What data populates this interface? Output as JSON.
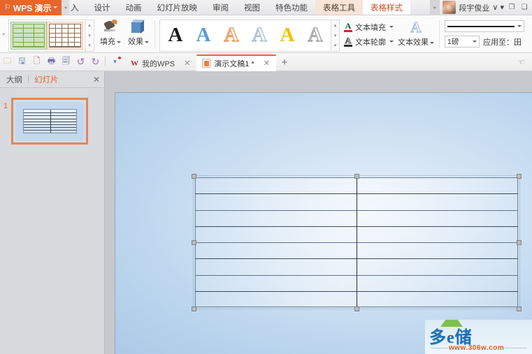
{
  "app": {
    "logo_text": "WPS 演示",
    "logo_icon": "wps-flag-icon",
    "logo_caret": "▾"
  },
  "menubar": {
    "scroll_left": "◂",
    "scroll_right": "▸",
    "tabs": [
      {
        "label": "入",
        "type": "clipped"
      },
      {
        "label": "设计",
        "type": "normal"
      },
      {
        "label": "动画",
        "type": "normal"
      },
      {
        "label": "幻灯片放映",
        "type": "normal"
      },
      {
        "label": "审阅",
        "type": "normal"
      },
      {
        "label": "视图",
        "type": "normal"
      },
      {
        "label": "特色功能",
        "type": "normal"
      },
      {
        "label": "表格工具",
        "type": "context"
      },
      {
        "label": "表格样式",
        "type": "context-active"
      }
    ],
    "user_name": "段宇俊业",
    "user_caret": "∨ ▾",
    "window_icons": [
      "restore-icon",
      "minimize-icon"
    ]
  },
  "ribbon": {
    "collapse_arrow": "◂",
    "table_styles": {
      "nav_up": "▴",
      "nav_down": "▾",
      "nav_more": "▾",
      "items": [
        {
          "name": "green-table-style",
          "selected": true
        },
        {
          "name": "plain-table-style",
          "selected": false
        }
      ]
    },
    "fill_button": {
      "label": "填充",
      "icon": "paint-bucket-icon",
      "caret": "▾"
    },
    "effect_button": {
      "label": "效果",
      "icon": "cube-effect-icon",
      "caret": "▾"
    },
    "wordart": {
      "nav_up": "▴",
      "nav_down": "▾",
      "nav_more": "▾",
      "glyph": "A",
      "styles": [
        "solid-black",
        "solid-blue",
        "outline-orange",
        "outline-white",
        "solid-gold",
        "outline-gray"
      ]
    },
    "text_fill": {
      "label": "文本填充",
      "icon": "text-fill-icon",
      "caret": "▾"
    },
    "text_outline": {
      "label": "文本轮廓",
      "icon": "text-outline-icon",
      "caret": "▾"
    },
    "text_effect": {
      "label": "文本效果",
      "icon": "text-effect-icon",
      "glyph": "A",
      "caret": "▾"
    },
    "line_style": {
      "caret": "▾"
    },
    "line_weight": {
      "value": "1磅",
      "caret": "▾"
    },
    "apply_to": {
      "label": "应用至：",
      "value": "田"
    }
  },
  "quickaccess": {
    "buttons": [
      {
        "name": "open-icon",
        "glyph": "📂"
      },
      {
        "name": "save-icon",
        "glyph": "💾"
      },
      {
        "name": "export-pdf-icon",
        "glyph": "🄰"
      },
      {
        "name": "print-icon",
        "glyph": "🖨"
      },
      {
        "name": "print-preview-icon",
        "glyph": "🔍"
      },
      {
        "name": "undo-icon",
        "glyph": "↺"
      },
      {
        "name": "redo-icon",
        "glyph": "↻"
      },
      {
        "name": "customize-icon",
        "glyph": "▾"
      }
    ],
    "tabs": [
      {
        "label": "我的WPS",
        "icon": "wps-w-icon",
        "active": false,
        "close": "✕"
      },
      {
        "label": "演示文稿1 *",
        "icon": "presentation-file-icon",
        "active": true,
        "close": "✕"
      }
    ],
    "add_tab": "+",
    "right_icon": "hand-pointer-icon"
  },
  "leftpanel": {
    "tab_outline": "大纲",
    "tab_slides": "幻灯片",
    "close": "✕",
    "slides": [
      {
        "number": "1",
        "selected": true,
        "rows": 8,
        "columns": 2
      }
    ]
  },
  "slide": {
    "table": {
      "rows": 8,
      "columns": 2,
      "selected": true,
      "handles": [
        "nw",
        "n",
        "ne",
        "w",
        "e",
        "sw",
        "s",
        "se"
      ]
    }
  },
  "watermark": {
    "text": "多e储",
    "url": "www.306w.com",
    "leaf_icon": "leaf-icon"
  }
}
